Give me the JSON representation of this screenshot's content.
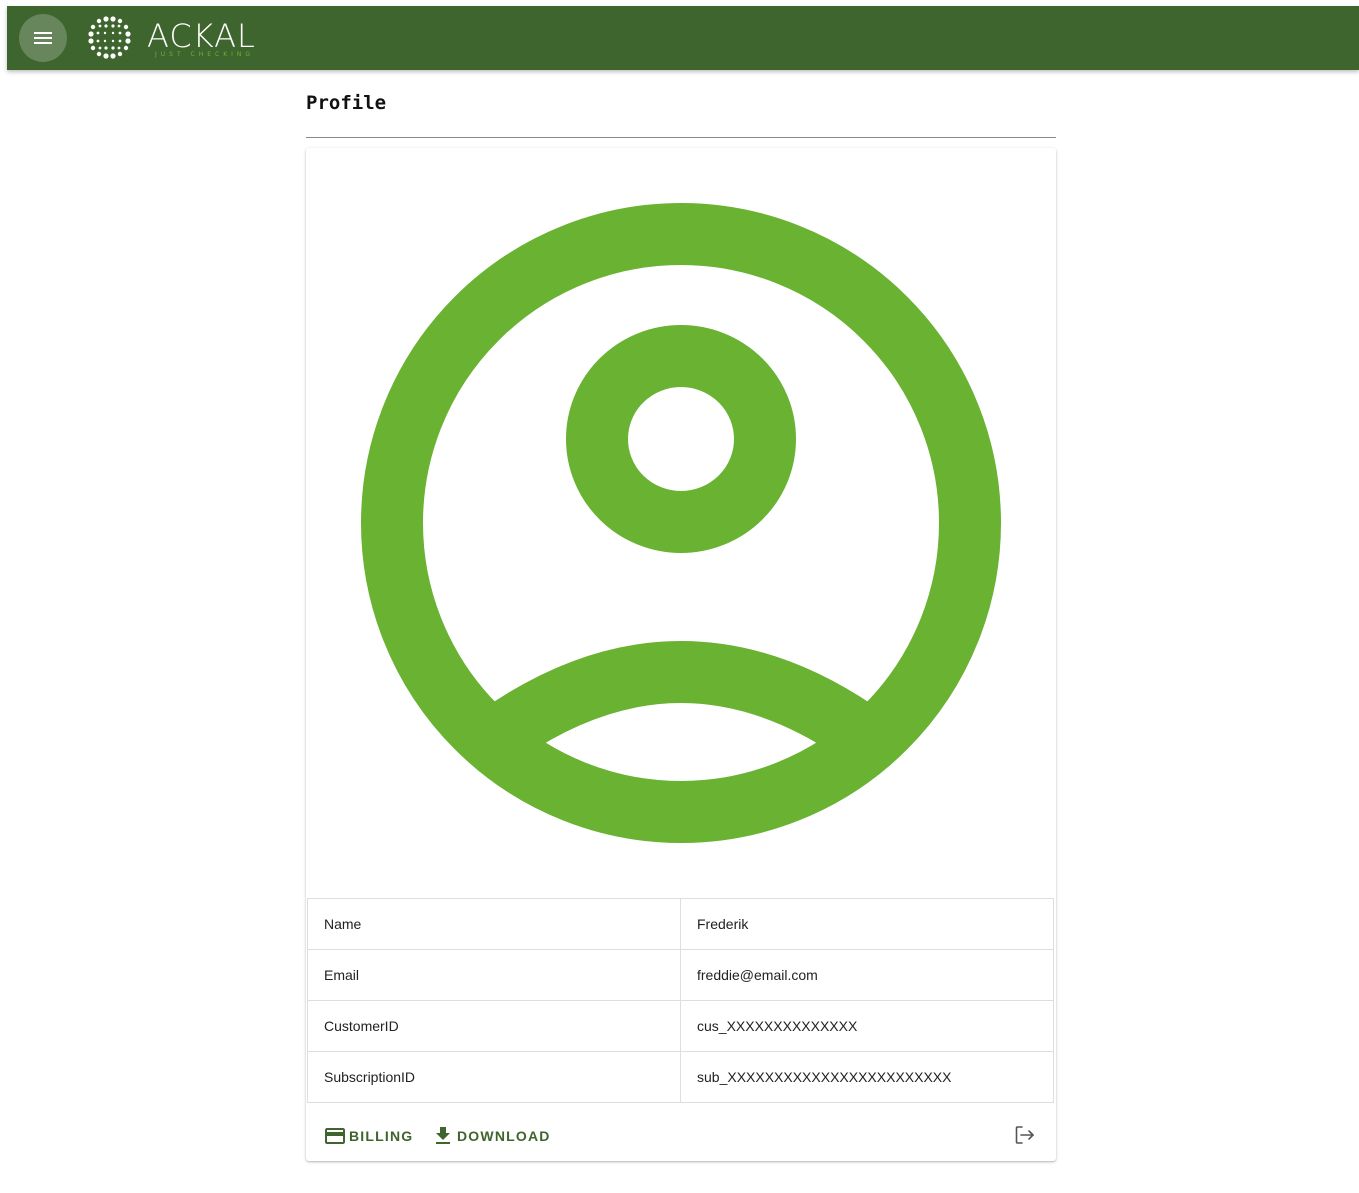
{
  "header": {
    "brand": "ACKAL",
    "tagline": "JUST CHECKING",
    "menu_icon": "hamburger-icon",
    "colors": {
      "bar": "#3d652d",
      "accent": "#6cb33e"
    }
  },
  "page": {
    "title": "Profile"
  },
  "avatar": {
    "icon": "account-circle-icon",
    "color": "#69b232"
  },
  "profile": {
    "rows": [
      {
        "label": "Name",
        "value": "Frederik"
      },
      {
        "label": "Email",
        "value": "freddie@email.com"
      },
      {
        "label": "CustomerID",
        "value": "cus_XXXXXXXXXXXXXX"
      },
      {
        "label": "SubscriptionID",
        "value": "sub_XXXXXXXXXXXXXXXXXXXXXXXX"
      }
    ]
  },
  "actions": {
    "billing_label": "BILLING",
    "download_label": "DOWNLOAD",
    "logout_icon": "logout-icon"
  }
}
